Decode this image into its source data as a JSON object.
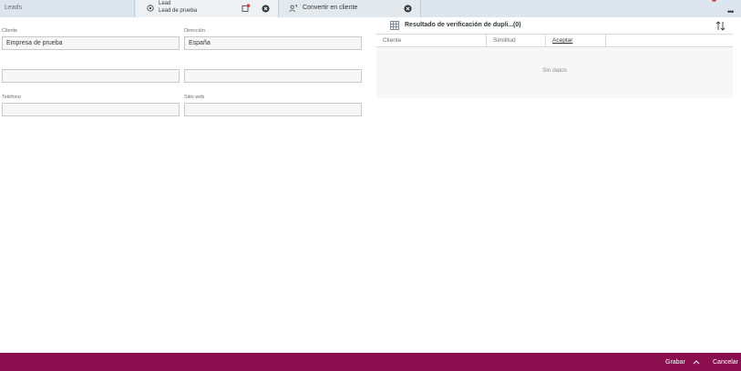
{
  "tabs": {
    "leads": "Leads",
    "lead": {
      "type": "Lead",
      "name": "Lead de prueba"
    },
    "convert": "Convertir en cliente",
    "overflow": "•••"
  },
  "form": {
    "cliente": {
      "label": "Cliente",
      "value": "Empresa de prueba"
    },
    "direccion": {
      "label": "Dirección",
      "value": "España"
    },
    "row2_left": {
      "value": ""
    },
    "row2_right": {
      "value": ""
    },
    "telefono": {
      "label": "Teléfono",
      "value": ""
    },
    "sitio_web": {
      "label": "Sitio web",
      "value": ""
    }
  },
  "duplicates": {
    "title": "Resultado de verificación de dupli...",
    "count": "(0)",
    "columns": [
      "Cliente",
      "Similitud",
      "Aceptar"
    ],
    "empty_text": "Sin datos"
  },
  "footer": {
    "save": "Grabar",
    "cancel": "Cancelar"
  },
  "colors": {
    "footer_bg": "#8b0f4f",
    "tab_strip_bg": "#dde5ee",
    "notification_red": "#d14040"
  },
  "icons": {
    "lead_tab": "lead-icon",
    "lead_note": "note-with-notification-icon",
    "convert_tab": "convert-person-icon",
    "close": "close-circle-icon",
    "duplicates": "grid-icon",
    "sort": "sort-icon",
    "footer_menu": "chevron-up-icon"
  }
}
